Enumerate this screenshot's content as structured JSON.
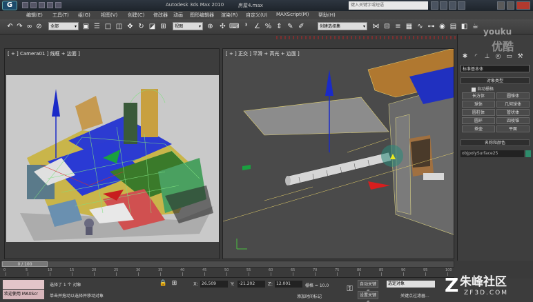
{
  "window": {
    "title": "Autodesk 3ds Max 2010",
    "file": "房屋4.max",
    "search_placeholder": "键入关键字或短语"
  },
  "menu": [
    "编辑(E)",
    "工具(T)",
    "组(G)",
    "视图(V)",
    "创建(C)",
    "修改器",
    "动画",
    "图形编辑器",
    "渲染(R)",
    "自定义(U)",
    "MAXScript(M)",
    "帮助(H)"
  ],
  "toolbar": {
    "selection_filter": "全部",
    "coord_system": "视图",
    "named_selection": "创建选择集"
  },
  "viewports": {
    "left_label": "[ + ] Camera01 ] 线框 + 边面 ]",
    "right_label": "[ + ] 正交 ] 平滑 + 高光 + 边面 ]"
  },
  "command_panel": {
    "category": "标准基本体",
    "object_type_header": "对象类型",
    "autogrid": "自动栅格",
    "primitives": [
      "长方体",
      "圆锥体",
      "球体",
      "几何球体",
      "圆柱体",
      "管状体",
      "圆环",
      "四棱锥",
      "茶壶",
      "平面"
    ],
    "name_color_header": "名称和颜色",
    "object_name": "objpolySurface25"
  },
  "watermark": {
    "line1": "youku",
    "line2": "优酷"
  },
  "timeline": {
    "frame": "0 / 100",
    "ticks": [
      "0",
      "5",
      "10",
      "15",
      "20",
      "25",
      "30",
      "35",
      "40",
      "45",
      "50",
      "55",
      "60",
      "65",
      "70",
      "75",
      "80",
      "85",
      "90",
      "95",
      "100"
    ]
  },
  "status": {
    "maxscript": "欢迎使用 MAXScr",
    "selection": "选择了 1 个 对象",
    "prompt": "单击并拖动以选择并移动对象",
    "x_label": "X:",
    "x": "26.509",
    "y_label": "Y:",
    "y": "-21.202",
    "z_label": "Z:",
    "z": "12.001",
    "grid": "栅格 = 10.0",
    "add_time_tag": "添加时间标记",
    "auto_key": "自动关键点",
    "set_key": "设置关键点",
    "key_mode": "选定对象",
    "key_filters": "关键点过滤器..."
  },
  "brand": {
    "site_name": "朱峰社区",
    "url": "ZF3D.COM"
  }
}
